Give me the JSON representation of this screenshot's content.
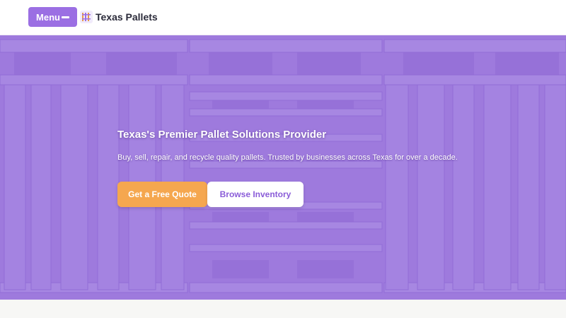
{
  "header": {
    "menu_label": "Menu",
    "menu_icon": "hamburger-icon",
    "brand_name": "Texas Pallets",
    "logo_icon": "pallet-logo-icon"
  },
  "hero": {
    "title": "Texas's Premier Pallet Solutions Provider",
    "subtitle": "Buy, sell, repair, and recycle quality pallets. Trusted by businesses across Texas for over a decade.",
    "primary_button": "Get a Free Quote",
    "secondary_button": "Browse Inventory",
    "background": "stacked-wooden-pallets-image"
  },
  "colors": {
    "accent": "#9b6fe3",
    "primary_button": "#f5a74f",
    "secondary_button_text": "#8a5cd8",
    "overlay": "#966ee1"
  }
}
